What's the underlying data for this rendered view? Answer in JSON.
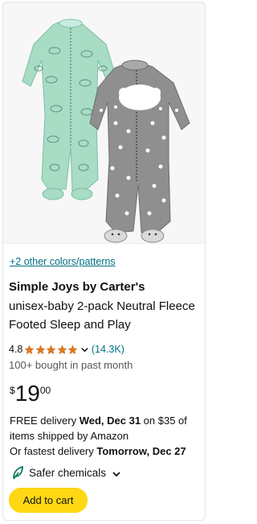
{
  "product": {
    "colors_link": "+2 other colors/patterns",
    "brand": "Simple Joys by Carter's",
    "title": "unisex-baby 2-pack Neutral Fleece Footed Sleep and Play",
    "rating": {
      "value": "4.8",
      "stars": 4.8,
      "max_stars": 5,
      "review_count": "(14.3K)"
    },
    "bought": "100+ bought in past month",
    "price": {
      "symbol": "$",
      "whole": "19",
      "fraction": "00"
    },
    "delivery": {
      "line1_prefix": "FREE delivery ",
      "line1_date": "Wed, Dec 31",
      "line1_suffix": " on $35 of items shipped by Amazon",
      "line2_prefix": "Or fastest delivery ",
      "line2_date": "Tomorrow, Dec 27"
    },
    "safer_label": "Safer chemicals",
    "add_to_cart": "Add to cart"
  },
  "colors": {
    "link": "#007185",
    "star": "#de7921",
    "button": "#ffd814",
    "leaf": "#067d62",
    "mint": "#a8dcc4",
    "grey_pajama": "#8f8f8f"
  },
  "icons": [
    "product-image",
    "star-icon",
    "chevron-down-icon",
    "leaf-icon"
  ]
}
